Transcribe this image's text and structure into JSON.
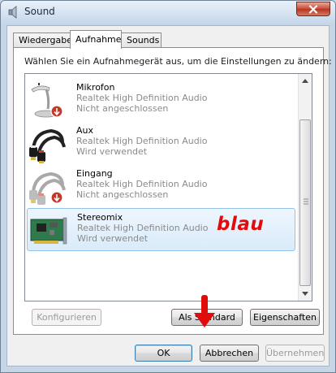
{
  "window": {
    "title": "Sound",
    "close_symbol": "x",
    "icon": "speaker-icon"
  },
  "tabs": [
    {
      "label": "Wiedergabe",
      "active": false
    },
    {
      "label": "Aufnahme",
      "active": true
    },
    {
      "label": "Sounds",
      "active": false
    }
  ],
  "panel": {
    "instruction": "Wählen Sie ein Aufnahmegerät aus, um die Einstellungen zu ändern:",
    "devices": [
      {
        "name": "Mikrofon",
        "driver": "Realtek High Definition Audio",
        "status": "Nicht angeschlossen",
        "icon": "microphone-icon",
        "selected": false
      },
      {
        "name": "Aux",
        "driver": "Realtek High Definition Audio",
        "status": "Wird verwendet",
        "icon": "rca-cable-icon",
        "selected": false
      },
      {
        "name": "Eingang",
        "driver": "Realtek High Definition Audio",
        "status": "Nicht angeschlossen",
        "icon": "line-in-cable-icon",
        "selected": false
      },
      {
        "name": "Stereomix",
        "driver": "Realtek High Definition Audio",
        "status": "Wird verwendet",
        "icon": "sound-card-icon",
        "selected": true
      }
    ],
    "annotation": "blau",
    "buttons": {
      "configure": "Konfigurieren",
      "set_default": "Als Standard",
      "properties": "Eigenschaften"
    }
  },
  "footer": {
    "ok": "OK",
    "cancel": "Abbrechen",
    "apply": "Übernehmen"
  },
  "colors": {
    "annotation": "#e20b0b",
    "selection_border": "#94c2ea",
    "status_badge": "#c0392b"
  }
}
